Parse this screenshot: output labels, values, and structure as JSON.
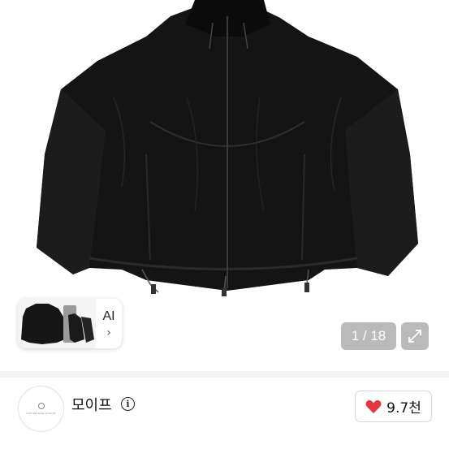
{
  "product": {
    "image_alt": "black nylon zip-up jacket"
  },
  "ai_card": {
    "label": "AI",
    "chevron": "›",
    "thumbnail_icon": "jacket-thumbnail"
  },
  "gallery": {
    "counter": "1 / 18",
    "expand_icon": "expand-icon"
  },
  "seller": {
    "name": "모이프",
    "avatar_caption": "moif because product",
    "info_icon": "info-icon"
  },
  "like": {
    "count": "9.7천",
    "icon": "heart-icon",
    "color": "#e8343f"
  }
}
